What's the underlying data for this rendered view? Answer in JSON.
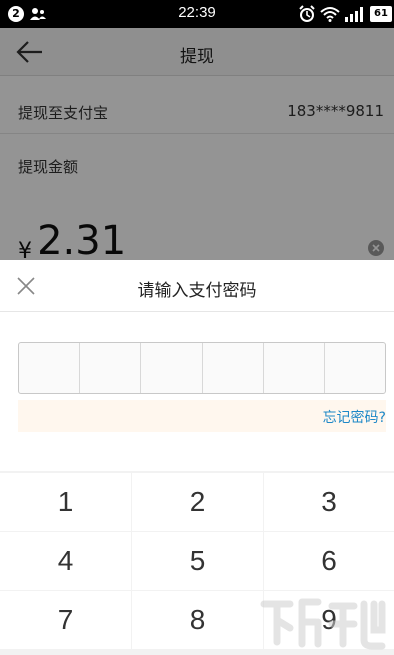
{
  "status_bar": {
    "notification_count": "2",
    "time": "22:39",
    "battery": "61",
    "icons": [
      "user-icon",
      "alarm-icon",
      "wifi-icon",
      "signal-icon"
    ]
  },
  "page": {
    "title": "提现",
    "alipay_label": "提现至支付宝",
    "alipay_account": "183****9811",
    "amount_label": "提现金额",
    "currency_symbol": "¥",
    "amount": "2.31"
  },
  "password_dialog": {
    "title": "请输入支付密码",
    "digits_count": 6,
    "forgot_link": "忘记密码?"
  },
  "keypad": {
    "keys": [
      "1",
      "2",
      "3",
      "4",
      "5",
      "6",
      "7",
      "8",
      "9"
    ]
  },
  "colors": {
    "link": "#1e88c7",
    "overlay": "rgba(0,0,0,0.42)",
    "keypad_bg": "#f2f2f2"
  }
}
